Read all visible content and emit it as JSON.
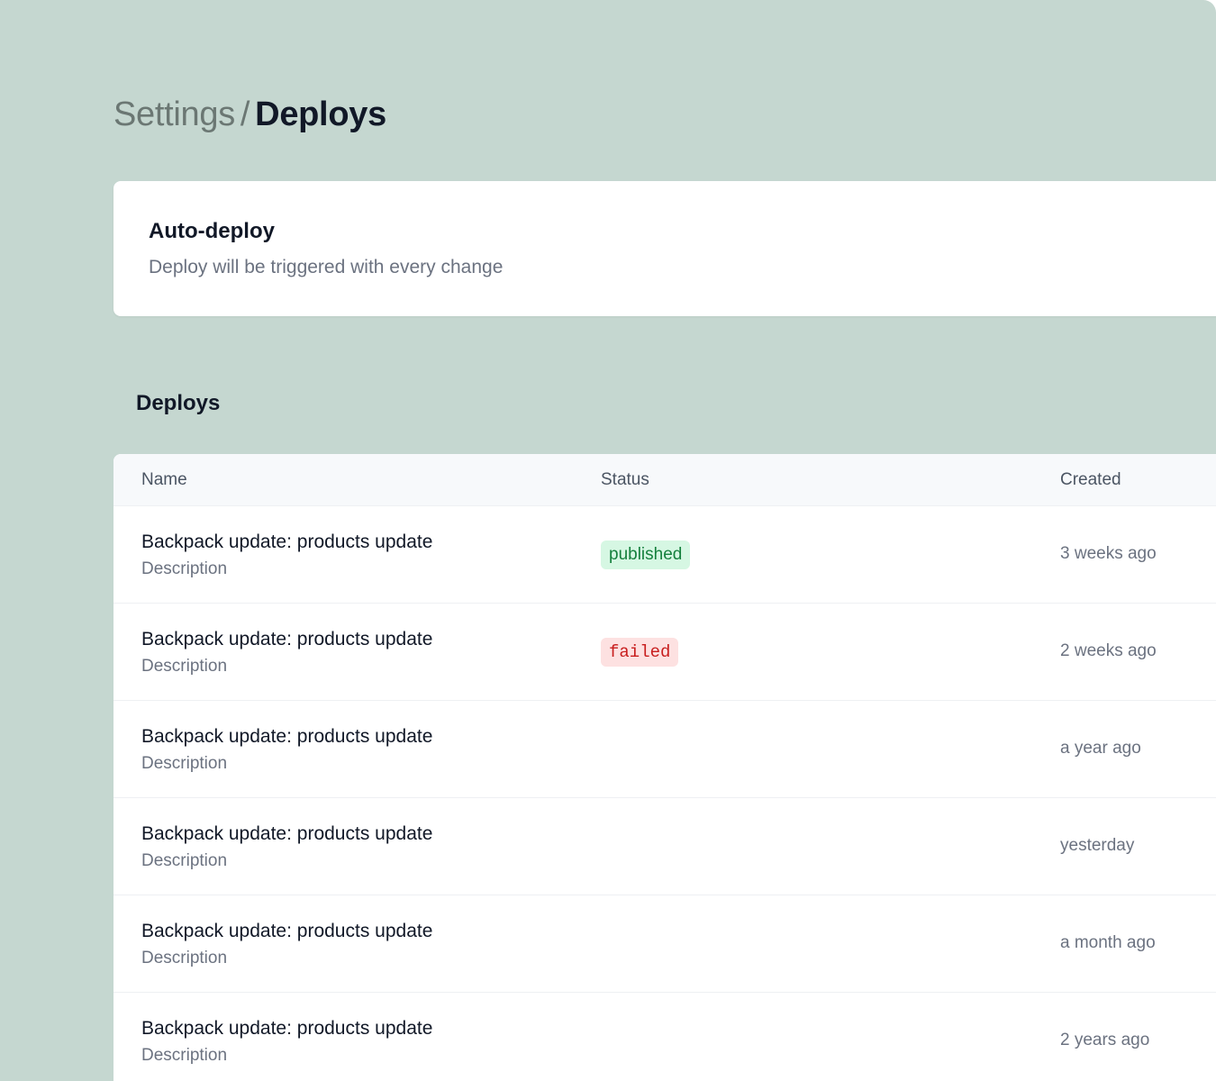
{
  "breadcrumb": {
    "parent": "Settings",
    "separator": "/",
    "current": "Deploys"
  },
  "auto_deploy": {
    "title": "Auto-deploy",
    "description": "Deploy will be triggered with every change"
  },
  "deploys_section": {
    "title": "Deploys"
  },
  "table": {
    "headers": {
      "name": "Name",
      "status": "Status",
      "created": "Created"
    },
    "rows": [
      {
        "title": "Backpack update: products update",
        "description": "Description",
        "status": "published",
        "created": "3 weeks ago"
      },
      {
        "title": "Backpack update: products update",
        "description": "Description",
        "status": "failed",
        "created": "2 weeks ago"
      },
      {
        "title": "Backpack update: products update",
        "description": "Description",
        "status": "",
        "created": "a year ago"
      },
      {
        "title": "Backpack update: products update",
        "description": "Description",
        "status": "",
        "created": "yesterday"
      },
      {
        "title": "Backpack update: products update",
        "description": "Description",
        "status": "",
        "created": "a month ago"
      },
      {
        "title": "Backpack update: products update",
        "description": "Description",
        "status": "",
        "created": "2 years ago"
      }
    ]
  },
  "colors": {
    "background": "#c5d7d0",
    "published_bg": "#d6f7e3",
    "published_text": "#15803d",
    "failed_bg": "#fde1e1",
    "failed_text": "#c81e1e"
  }
}
